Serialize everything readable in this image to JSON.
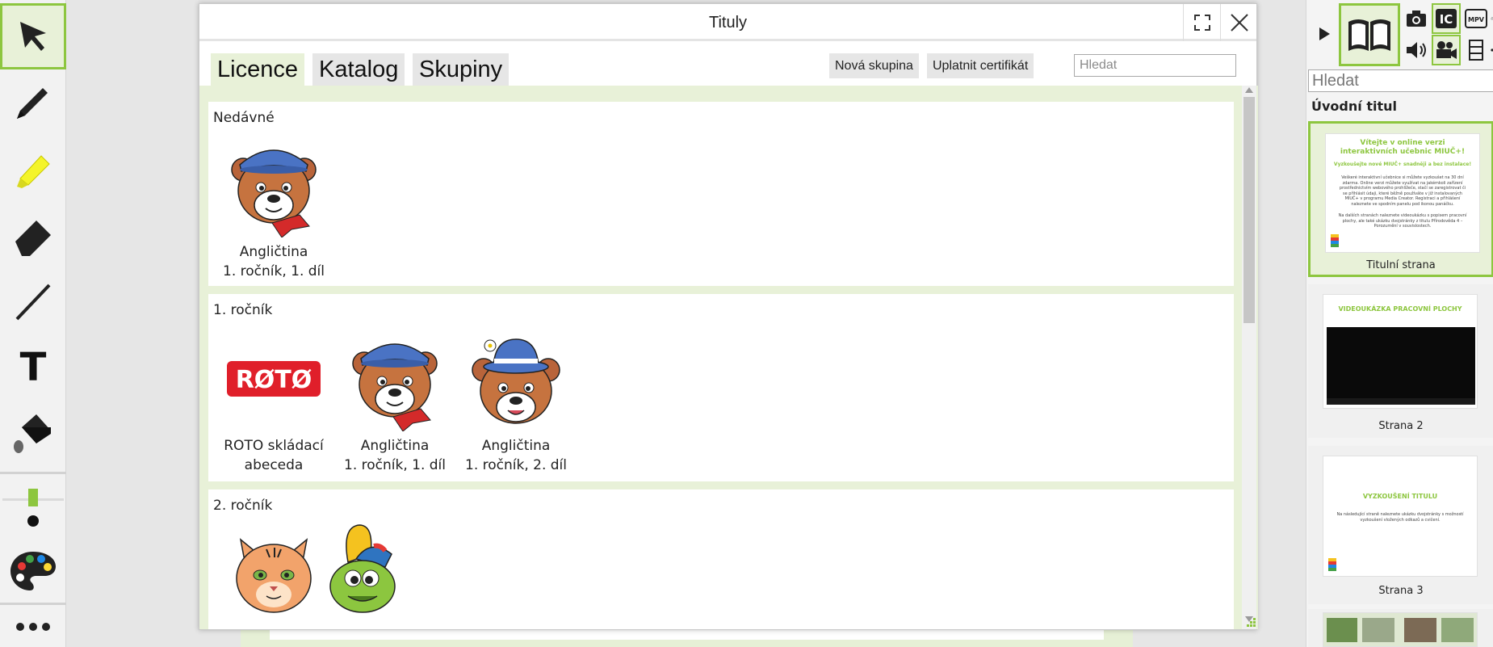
{
  "dialog": {
    "title": "Tituly",
    "tabs": [
      {
        "label": "Licence",
        "active": true
      },
      {
        "label": "Katalog",
        "active": false
      },
      {
        "label": "Skupiny",
        "active": false
      }
    ],
    "new_group_label": "Nová skupina",
    "apply_certificate_label": "Uplatnit certifikát",
    "search_placeholder": "Hledat",
    "sections": [
      {
        "title": "Nedávné",
        "items": [
          {
            "line1": "Angličtina",
            "line2": "1. ročník, 1. díl",
            "icon": "bear-cap-icon"
          }
        ]
      },
      {
        "title": "1. ročník",
        "items": [
          {
            "line1": "ROTO skládací",
            "line2": "abeceda",
            "icon": "roto-logo-icon",
            "logo_text": "RØTØ"
          },
          {
            "line1": "Angličtina",
            "line2": "1. ročník, 1. díl",
            "icon": "bear-cap-icon"
          },
          {
            "line1": "Angličtina",
            "line2": "1. ročník, 2. díl",
            "icon": "bear-hat-icon"
          }
        ]
      },
      {
        "title": "2. ročník",
        "items": [
          {
            "icon": "tiger-icon"
          },
          {
            "icon": "frog-cap-icon"
          }
        ]
      }
    ]
  },
  "left_toolbar": {
    "tools": [
      "select-arrow-icon",
      "pen-icon",
      "highlighter-icon",
      "eraser-icon",
      "line-icon",
      "text-icon",
      "fill-bucket-icon",
      "stroke-size-icon",
      "palette-icon",
      "more-icon"
    ],
    "text_tool_glyph": "T"
  },
  "right_panel": {
    "icons": [
      "camera-icon",
      "ic-icon",
      "mpv-icon",
      "bell-icon",
      "speaker-icon",
      "video-camera-icon",
      "film-strip-icon",
      "globe-icon"
    ],
    "ic_label": "IC",
    "mpv_label": "MPV",
    "search_placeholder": "Hledat",
    "heading": "Úvodní titul",
    "pages": [
      {
        "label": "Titulní strana",
        "title": "Vítejte v online verzi interaktivních učebnic MIUČ+!",
        "subtitle": "Vyzkoušejte nové MIUČ+ snadněji a bez instalace!",
        "body": "Veškeré interaktivní učebnice si můžete vyzkoušet na 30 dní zdarma. Online verzi můžete využívat na jakémkoli zařízení prostřednictvím webového prohlížeče, stačí se zaregistrovat či se přihlásit údaji, které běžně používáte v již instalovaných MIUČ+ v programu Media Creator. Registraci a přihlášení naleznete ve spodním panelu pod ikonou panáčku.",
        "body2": "Na dalších stranách naleznete videoukázku s popisem pracovní plochy, ale také ukázku dvojstránky z titulu Přírodověda 4 – Porozumění v souvislostech."
      },
      {
        "label": "Strana 2",
        "title": "VIDEOUKÁZKA PRACOVNÍ PLOCHY"
      },
      {
        "label": "Strana 3",
        "title": "VYZKOUŠENÍ TITULU",
        "body": "Na následující straně naleznete ukázku dvojstránky s možností vyzkoušení vložených odkazů a cvičení."
      }
    ]
  },
  "colors": {
    "accent": "#8dc63f",
    "accent_light": "#e8f1d8",
    "highlighter": "#f4f42a"
  }
}
